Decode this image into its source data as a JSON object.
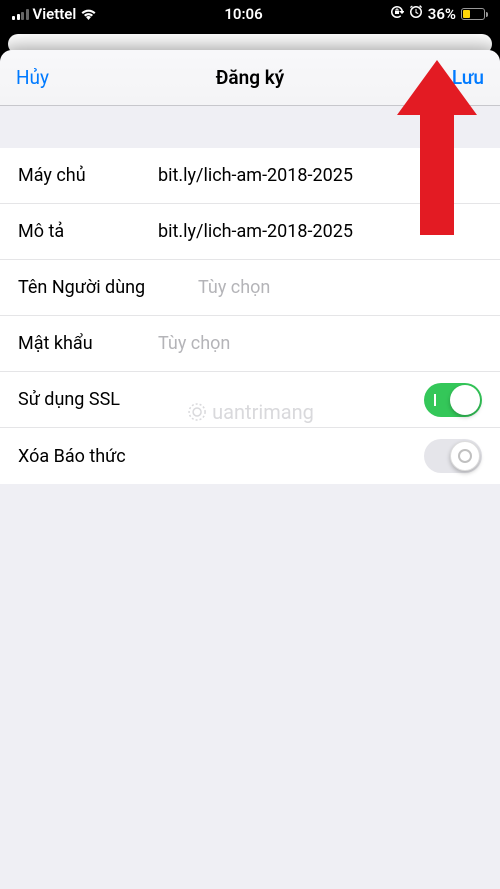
{
  "status_bar": {
    "carrier": "Viettel",
    "time": "10:06",
    "battery_pct": "36%",
    "battery_fill_width": "36%"
  },
  "nav": {
    "cancel": "Hủy",
    "title": "Đăng ký",
    "save": "Lưu"
  },
  "fields": {
    "server_label": "Máy chủ",
    "server_value": "bit.ly/lich-am-2018-2025",
    "description_label": "Mô tả",
    "description_value": "bit.ly/lich-am-2018-2025",
    "username_label": "Tên Người dùng",
    "username_placeholder": "Tùy chọn",
    "password_label": "Mật khẩu",
    "password_placeholder": "Tùy chọn",
    "ssl_label": "Sử dụng SSL",
    "ssl_on": true,
    "delete_alarms_label": "Xóa Báo thức",
    "delete_alarms_on": false
  },
  "watermark": "uantrimang",
  "colors": {
    "accent": "#007aff",
    "switch_on": "#34c759",
    "bg_group": "#efeff4",
    "arrow": "#e31b23"
  }
}
